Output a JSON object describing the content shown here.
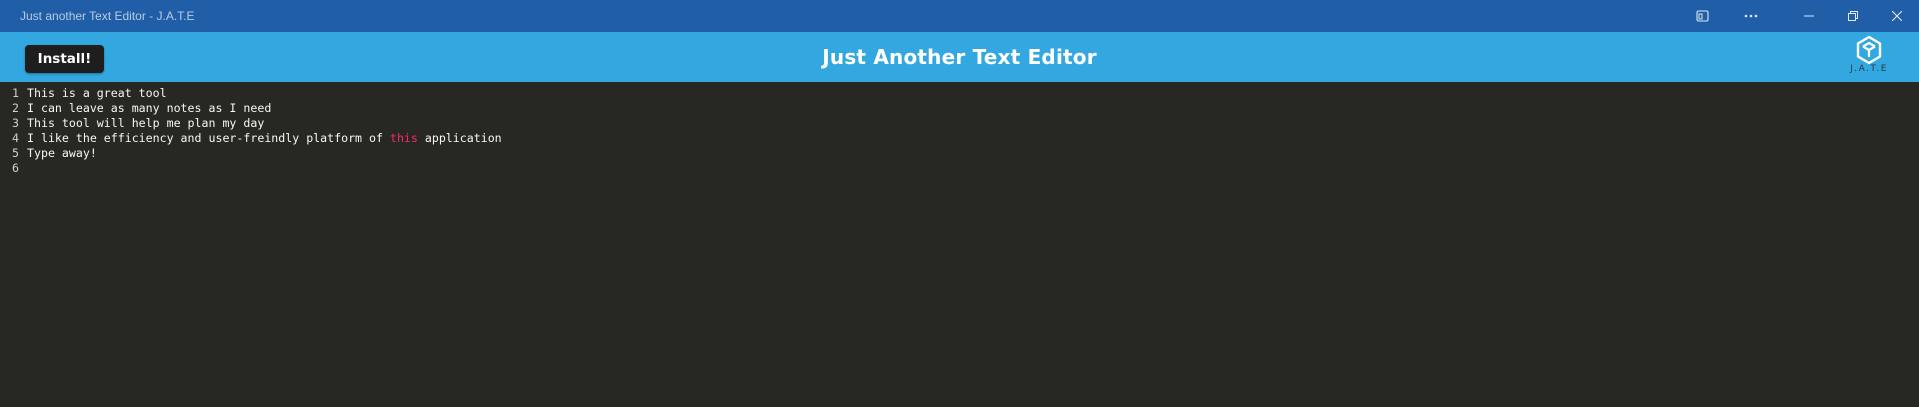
{
  "window": {
    "title": "Just another Text Editor - J.A.T.E",
    "controls": [
      "app-view-icon",
      "more-icon",
      "minimize-icon",
      "restore-icon",
      "close-icon"
    ]
  },
  "navbar": {
    "install_label": "Install!",
    "heading": "Just Another Text Editor",
    "logo_text": "J.A.T.E"
  },
  "editor": {
    "lines": [
      {
        "number": "1",
        "text": "This is a great tool"
      },
      {
        "number": "2",
        "text": "I can leave as many notes as I need"
      },
      {
        "number": "3",
        "text": "This tool will help me plan my day"
      },
      {
        "number": "4",
        "before": "I like the efficiency and user-freindly platform of ",
        "keyword": "this",
        "after": " application"
      },
      {
        "number": "5",
        "text": "Type away!"
      },
      {
        "number": "6",
        "text": ""
      }
    ]
  },
  "colors": {
    "titlebar": "#205ea8",
    "navbar": "#33a8e0",
    "editor_bg": "#272822",
    "keyword": "#f92672"
  }
}
